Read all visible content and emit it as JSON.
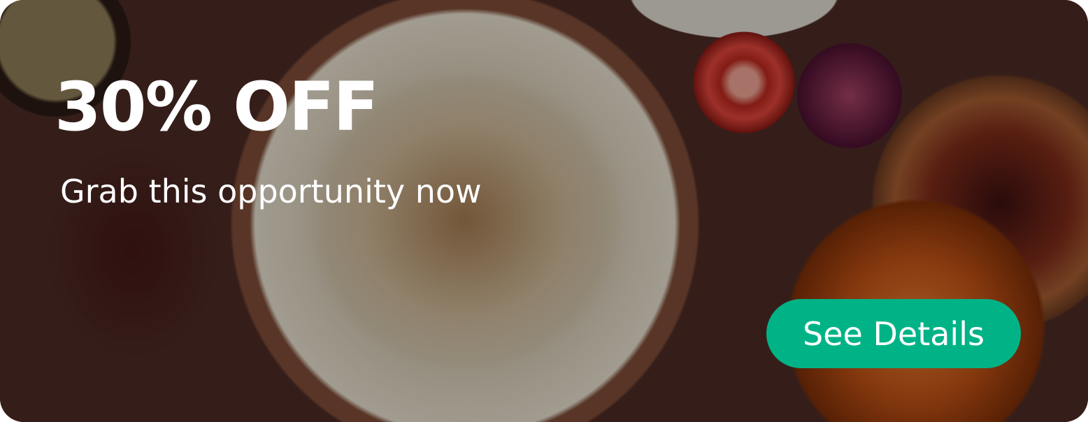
{
  "banner": {
    "title": "30% OFF",
    "subtitle": "Grab this opportunity now",
    "cta_label": "See Details",
    "accent_color": "#00b386"
  }
}
